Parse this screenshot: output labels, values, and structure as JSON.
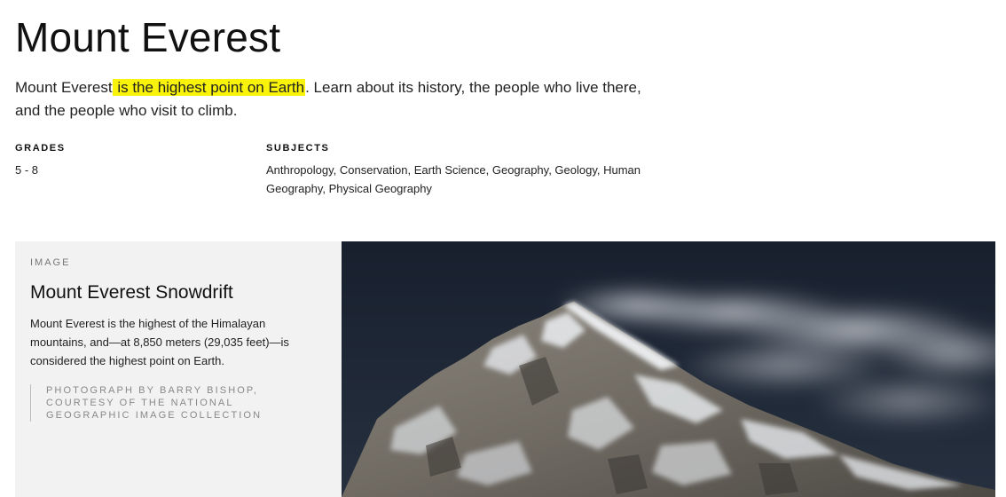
{
  "page": {
    "title": "Mount Everest",
    "intro": {
      "before": "Mount Everest",
      "highlight": " is the highest point on Earth",
      "after": ". Learn about its history, the people who live there, and the people who visit to climb."
    },
    "grades": {
      "label": "GRADES",
      "value": "5 - 8"
    },
    "subjects": {
      "label": "SUBJECTS",
      "value": "Anthropology, Conservation, Earth Science, Geography, Geology, Human Geography, Physical Geography"
    }
  },
  "media": {
    "eyebrow": "IMAGE",
    "title": "Mount Everest Snowdrift",
    "caption": "Mount Everest is the highest of the Himalayan mountains, and—at 8,850 meters (29,035 feet)—is considered the highest point on Earth.",
    "credit": "PHOTOGRAPH BY BARRY BISHOP, COURTESY OF THE NATIONAL GEOGRAPHIC IMAGE COLLECTION"
  },
  "colors": {
    "highlight": "#f9f20a",
    "card_background": "#f2f2f2",
    "sky": "#1c2331"
  }
}
